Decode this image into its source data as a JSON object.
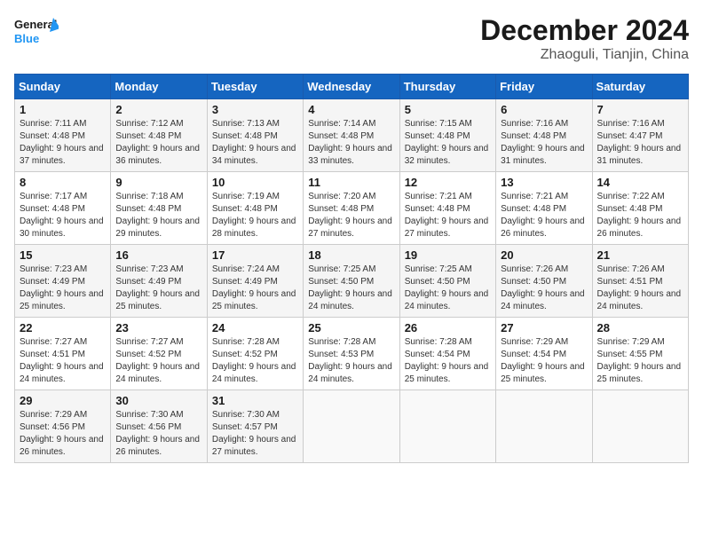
{
  "logo": {
    "line1": "General",
    "line2": "Blue"
  },
  "title": "December 2024",
  "location": "Zhaoguli, Tianjin, China",
  "weekdays": [
    "Sunday",
    "Monday",
    "Tuesday",
    "Wednesday",
    "Thursday",
    "Friday",
    "Saturday"
  ],
  "weeks": [
    [
      {
        "day": "1",
        "sunrise": "7:11 AM",
        "sunset": "4:48 PM",
        "daylight": "9 hours and 37 minutes."
      },
      {
        "day": "2",
        "sunrise": "7:12 AM",
        "sunset": "4:48 PM",
        "daylight": "9 hours and 36 minutes."
      },
      {
        "day": "3",
        "sunrise": "7:13 AM",
        "sunset": "4:48 PM",
        "daylight": "9 hours and 34 minutes."
      },
      {
        "day": "4",
        "sunrise": "7:14 AM",
        "sunset": "4:48 PM",
        "daylight": "9 hours and 33 minutes."
      },
      {
        "day": "5",
        "sunrise": "7:15 AM",
        "sunset": "4:48 PM",
        "daylight": "9 hours and 32 minutes."
      },
      {
        "day": "6",
        "sunrise": "7:16 AM",
        "sunset": "4:48 PM",
        "daylight": "9 hours and 31 minutes."
      },
      {
        "day": "7",
        "sunrise": "7:16 AM",
        "sunset": "4:47 PM",
        "daylight": "9 hours and 31 minutes."
      }
    ],
    [
      {
        "day": "8",
        "sunrise": "7:17 AM",
        "sunset": "4:48 PM",
        "daylight": "9 hours and 30 minutes."
      },
      {
        "day": "9",
        "sunrise": "7:18 AM",
        "sunset": "4:48 PM",
        "daylight": "9 hours and 29 minutes."
      },
      {
        "day": "10",
        "sunrise": "7:19 AM",
        "sunset": "4:48 PM",
        "daylight": "9 hours and 28 minutes."
      },
      {
        "day": "11",
        "sunrise": "7:20 AM",
        "sunset": "4:48 PM",
        "daylight": "9 hours and 27 minutes."
      },
      {
        "day": "12",
        "sunrise": "7:21 AM",
        "sunset": "4:48 PM",
        "daylight": "9 hours and 27 minutes."
      },
      {
        "day": "13",
        "sunrise": "7:21 AM",
        "sunset": "4:48 PM",
        "daylight": "9 hours and 26 minutes."
      },
      {
        "day": "14",
        "sunrise": "7:22 AM",
        "sunset": "4:48 PM",
        "daylight": "9 hours and 26 minutes."
      }
    ],
    [
      {
        "day": "15",
        "sunrise": "7:23 AM",
        "sunset": "4:49 PM",
        "daylight": "9 hours and 25 minutes."
      },
      {
        "day": "16",
        "sunrise": "7:23 AM",
        "sunset": "4:49 PM",
        "daylight": "9 hours and 25 minutes."
      },
      {
        "day": "17",
        "sunrise": "7:24 AM",
        "sunset": "4:49 PM",
        "daylight": "9 hours and 25 minutes."
      },
      {
        "day": "18",
        "sunrise": "7:25 AM",
        "sunset": "4:50 PM",
        "daylight": "9 hours and 24 minutes."
      },
      {
        "day": "19",
        "sunrise": "7:25 AM",
        "sunset": "4:50 PM",
        "daylight": "9 hours and 24 minutes."
      },
      {
        "day": "20",
        "sunrise": "7:26 AM",
        "sunset": "4:50 PM",
        "daylight": "9 hours and 24 minutes."
      },
      {
        "day": "21",
        "sunrise": "7:26 AM",
        "sunset": "4:51 PM",
        "daylight": "9 hours and 24 minutes."
      }
    ],
    [
      {
        "day": "22",
        "sunrise": "7:27 AM",
        "sunset": "4:51 PM",
        "daylight": "9 hours and 24 minutes."
      },
      {
        "day": "23",
        "sunrise": "7:27 AM",
        "sunset": "4:52 PM",
        "daylight": "9 hours and 24 minutes."
      },
      {
        "day": "24",
        "sunrise": "7:28 AM",
        "sunset": "4:52 PM",
        "daylight": "9 hours and 24 minutes."
      },
      {
        "day": "25",
        "sunrise": "7:28 AM",
        "sunset": "4:53 PM",
        "daylight": "9 hours and 24 minutes."
      },
      {
        "day": "26",
        "sunrise": "7:28 AM",
        "sunset": "4:54 PM",
        "daylight": "9 hours and 25 minutes."
      },
      {
        "day": "27",
        "sunrise": "7:29 AM",
        "sunset": "4:54 PM",
        "daylight": "9 hours and 25 minutes."
      },
      {
        "day": "28",
        "sunrise": "7:29 AM",
        "sunset": "4:55 PM",
        "daylight": "9 hours and 25 minutes."
      }
    ],
    [
      {
        "day": "29",
        "sunrise": "7:29 AM",
        "sunset": "4:56 PM",
        "daylight": "9 hours and 26 minutes."
      },
      {
        "day": "30",
        "sunrise": "7:30 AM",
        "sunset": "4:56 PM",
        "daylight": "9 hours and 26 minutes."
      },
      {
        "day": "31",
        "sunrise": "7:30 AM",
        "sunset": "4:57 PM",
        "daylight": "9 hours and 27 minutes."
      },
      null,
      null,
      null,
      null
    ]
  ]
}
